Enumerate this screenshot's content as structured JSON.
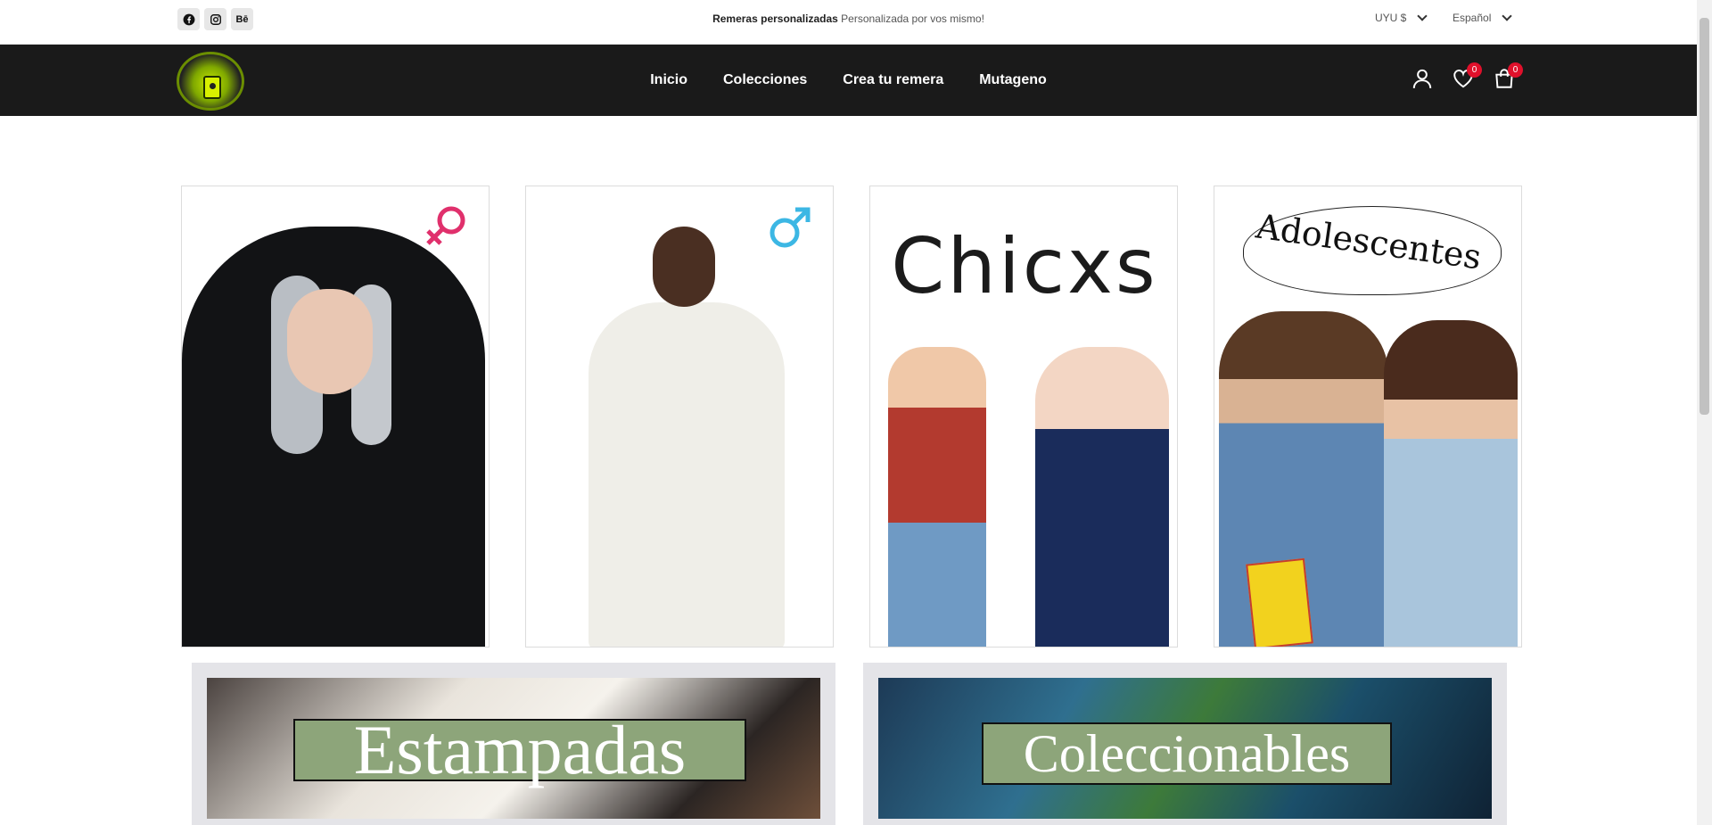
{
  "topbar": {
    "socials": [
      {
        "icon": "facebook-icon",
        "label": ""
      },
      {
        "icon": "instagram-icon",
        "label": ""
      },
      {
        "icon": "behance-icon",
        "label": "Bē"
      }
    ],
    "promo_bold": "Remeras personalizadas",
    "promo_text": " Personalizada por vos mismo!",
    "currency": "UYU $",
    "language": "Español"
  },
  "header": {
    "logo_alt": "MUTAGENO",
    "nav": [
      "Inicio",
      "Colecciones",
      "Crea tu remera",
      "Mutageno"
    ],
    "wishlist_count": "0",
    "cart_count": "0"
  },
  "categories": [
    {
      "name": "Mujer",
      "symbol": "female-symbol-icon",
      "color": "#e0306c"
    },
    {
      "name": "Hombre",
      "symbol": "male-symbol-icon",
      "color": "#3cb7e4"
    },
    {
      "name": "Chicxs",
      "title": "Chicxs"
    },
    {
      "name": "Adolescentes",
      "title": "Adolescentes"
    }
  ],
  "collections": [
    {
      "label": "Estampadas"
    },
    {
      "label": "Coleccionables"
    }
  ],
  "colors": {
    "header_bg": "#1a1a1a",
    "label_green": "#8da57a",
    "badge_red": "#e0102b"
  }
}
